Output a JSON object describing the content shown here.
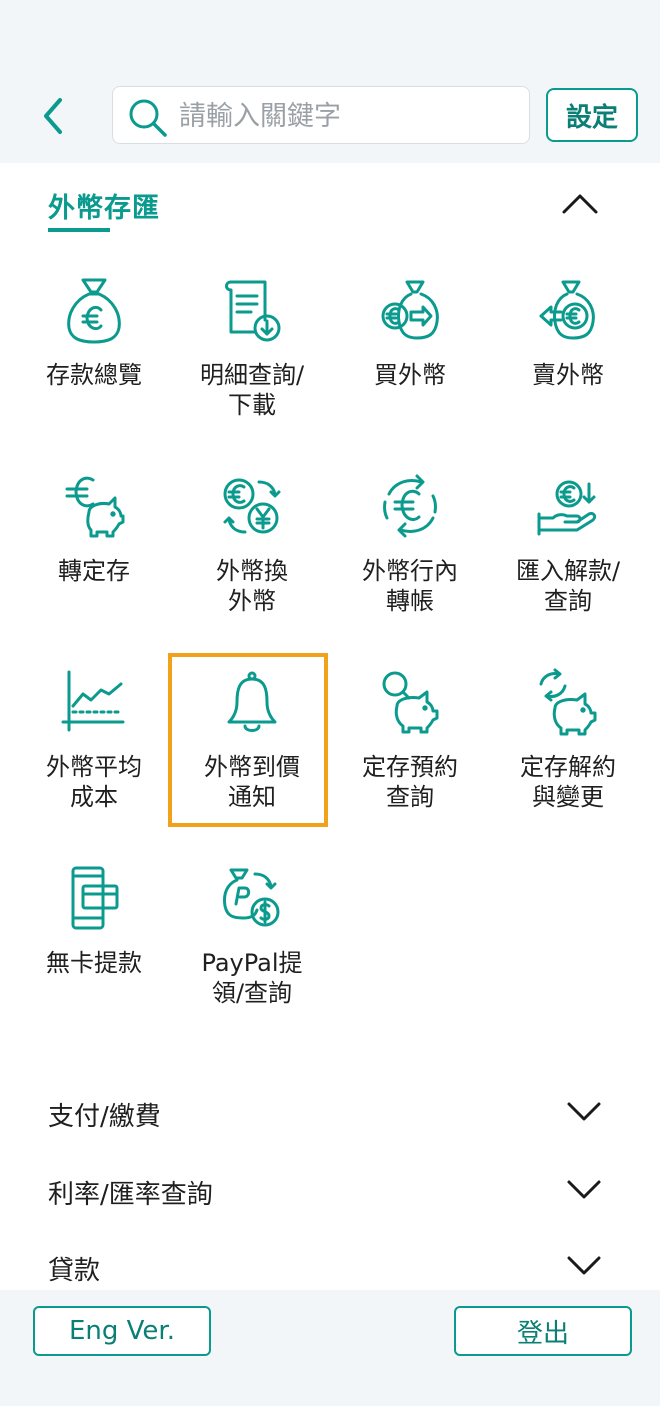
{
  "header": {
    "search_placeholder": "請輸入關鍵字",
    "settings_label": "設定"
  },
  "section": {
    "title": "外幣存匯",
    "tiles": [
      {
        "label": "存款總覽"
      },
      {
        "label": "明細查詢/\n下載"
      },
      {
        "label": "買外幣"
      },
      {
        "label": "賣外幣"
      },
      {
        "label": "轉定存"
      },
      {
        "label": "外幣換\n外幣"
      },
      {
        "label": "外幣行內\n轉帳"
      },
      {
        "label": "匯入解款/\n查詢"
      },
      {
        "label": "外幣平均\n成本"
      },
      {
        "label": "外幣到價\n通知"
      },
      {
        "label": "定存預約\n查詢"
      },
      {
        "label": "定存解約\n與變更"
      },
      {
        "label": "無卡提款"
      },
      {
        "label": "PayPal提\n領/查詢"
      }
    ]
  },
  "accordions": [
    {
      "label": "支付/繳費"
    },
    {
      "label": "利率/匯率查詢"
    },
    {
      "label": "貸款"
    }
  ],
  "footer": {
    "eng_label": "Eng Ver.",
    "logout_label": "登出"
  },
  "colors": {
    "accent": "#0b9a8e",
    "highlight": "#f2a11a",
    "header_bg": "#f3f6f8"
  }
}
